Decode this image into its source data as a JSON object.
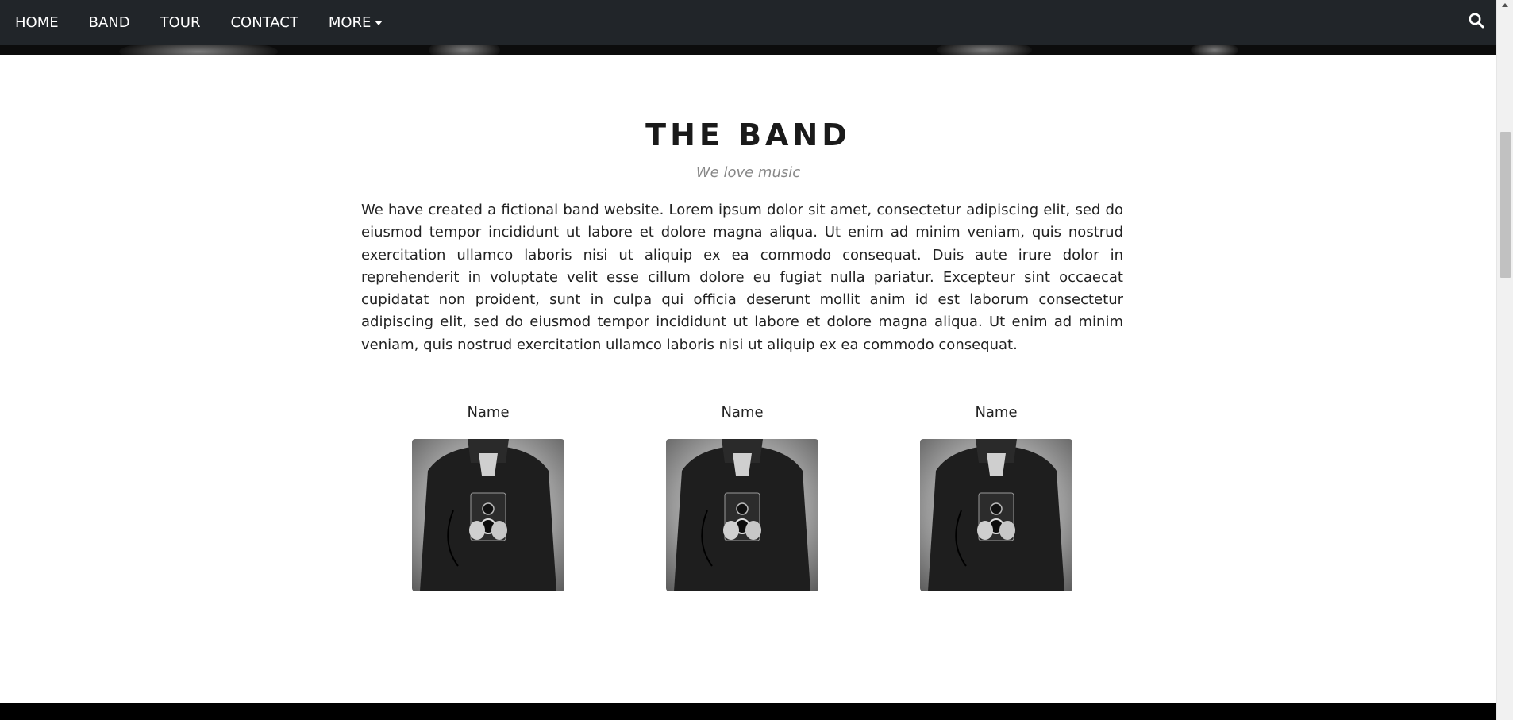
{
  "nav": {
    "items": [
      {
        "label": "HOME"
      },
      {
        "label": "BAND"
      },
      {
        "label": "TOUR"
      },
      {
        "label": "CONTACT"
      },
      {
        "label": "MORE"
      }
    ],
    "search_icon": "search-icon",
    "dropdown_icon": "caret-down-icon"
  },
  "band": {
    "title": "THE BAND",
    "subtitle": "We love music",
    "text": "We have created a fictional band website. Lorem ipsum dolor sit amet, consectetur adipiscing elit, sed do eiusmod tempor incididunt ut labore et dolore magna aliqua. Ut enim ad minim veniam, quis nostrud exercitation ullamco laboris nisi ut aliquip ex ea commodo consequat. Duis aute irure dolor in reprehenderit in voluptate velit esse cillum dolore eu fugiat nulla pariatur. Excepteur sint occaecat cupidatat non proident, sunt in culpa qui officia deserunt mollit anim id est laborum consectetur adipiscing elit, sed do eiusmod tempor incididunt ut labore et dolore magna aliqua. Ut enim ad minim veniam, quis nostrud exercitation ullamco laboris nisi ut aliquip ex ea commodo consequat.",
    "members": [
      {
        "name": "Name"
      },
      {
        "name": "Name"
      },
      {
        "name": "Name"
      }
    ]
  },
  "colors": {
    "navbar": "#212529",
    "footer": "#000000",
    "title": "#1a1a1a",
    "subtitle": "#888888"
  }
}
